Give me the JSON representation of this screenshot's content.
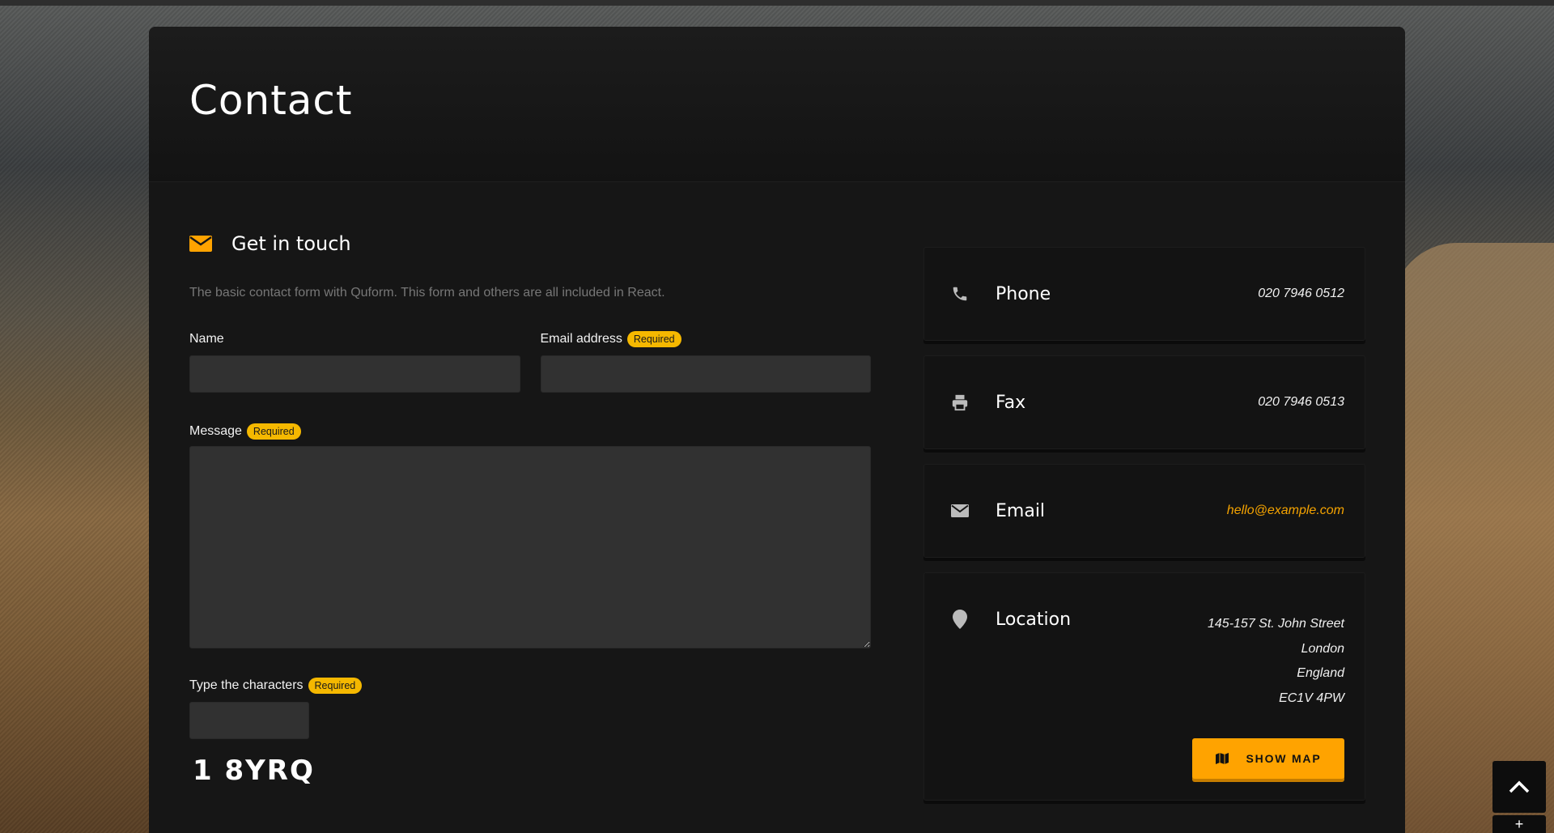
{
  "page": {
    "title": "Contact"
  },
  "form": {
    "heading": "Get in touch",
    "intro": "The basic contact form with Quform. This form and others are all included in React.",
    "required_label": "Required",
    "name_label": "Name",
    "name_value": "",
    "email_label": "Email address",
    "email_value": "",
    "message_label": "Message",
    "message_value": "",
    "captcha_label": "Type the characters",
    "captcha_value": "",
    "captcha_text": "1 8YRQ"
  },
  "contact_info": {
    "phone": {
      "label": "Phone",
      "value": "020 7946 0512",
      "icon": "phone-icon"
    },
    "fax": {
      "label": "Fax",
      "value": "020 7946 0513",
      "icon": "printer-icon"
    },
    "email": {
      "label": "Email",
      "value": "hello@example.com",
      "icon": "envelope-icon"
    },
    "location": {
      "label": "Location",
      "icon": "map-pin-icon",
      "address_lines": [
        "145-157 St. John Street",
        "London",
        "England",
        "EC1V 4PW"
      ],
      "map_button_label": "SHOW MAP"
    }
  },
  "controls": {
    "plus_label": "+"
  },
  "colors": {
    "accent": "#ffa300",
    "badge": "#f5b800",
    "panel": "#161616",
    "input": "#313131"
  }
}
